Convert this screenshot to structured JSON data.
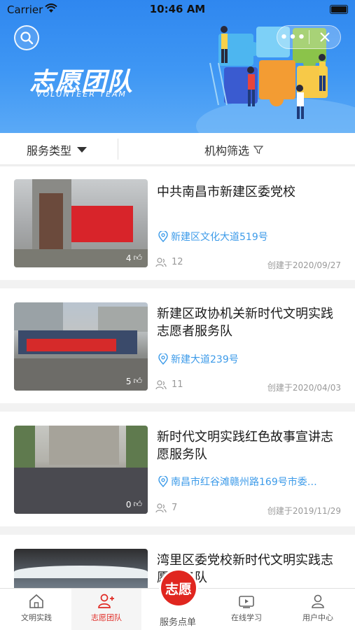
{
  "status_bar": {
    "carrier": "Carrier",
    "time": "10:46 AM"
  },
  "banner": {
    "title": "志愿团队",
    "subtitle": "VOLUNTEER TEAM",
    "more_icon": "more-dots-icon",
    "close_icon": "close-icon"
  },
  "filters": {
    "service_type": "服务类型",
    "org_filter": "机构筛选"
  },
  "teams": [
    {
      "name": "中共南昌市新建区委党校",
      "address": "新建区文化大道519号",
      "likes": "4",
      "members": "12",
      "created": "创建于2020/09/27"
    },
    {
      "name": "新建区政协机关新时代文明实践志愿者服务队",
      "address": "新建大道239号",
      "likes": "5",
      "members": "11",
      "created": "创建于2020/04/03"
    },
    {
      "name": "新时代文明实践红色故事宣讲志愿服务队",
      "address": "南昌市红谷滩赣州路169号市委…",
      "likes": "0",
      "members": "7",
      "created": "创建于2019/11/29"
    },
    {
      "name": "湾里区委党校新时代文明实践志愿服务队",
      "address": "",
      "likes": "",
      "members": "",
      "created": ""
    }
  ],
  "tabbar": {
    "items": [
      {
        "label": "文明实践",
        "icon": "home-icon"
      },
      {
        "label": "志愿团队",
        "icon": "team-icon"
      },
      {
        "label": "服务点单",
        "icon": "volunteer-badge-icon",
        "badge_text": "志愿"
      },
      {
        "label": "在线学习",
        "icon": "video-icon"
      },
      {
        "label": "用户中心",
        "icon": "user-icon"
      }
    ]
  },
  "colors": {
    "accent_red": "#e02a24",
    "banner_blue": "#3f97f4",
    "link_blue": "#3d9be9"
  }
}
